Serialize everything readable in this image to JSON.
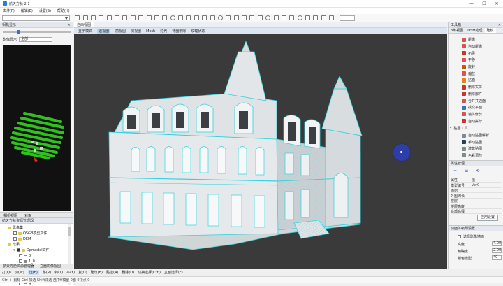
{
  "window": {
    "title": "航天方舱 2.1",
    "minimize": "—",
    "maximize": "☐",
    "close": "✕"
  },
  "menu": [
    "文件(F)",
    "编辑(E)",
    "设置(S)",
    "帮助(H)"
  ],
  "left_panel": {
    "title": "相机显示",
    "close": "×",
    "filter_label": "影像显示",
    "filter_value": "全部",
    "tabs": [
      "相机视图",
      "对象"
    ]
  },
  "tree": {
    "title": "航天方舱资源管理器",
    "items": [
      {
        "label": "影像集",
        "indent": 1,
        "kind": "folder",
        "checked": false,
        "toggle": ""
      },
      {
        "label": "OSGB模型文件",
        "indent": 2,
        "kind": "box",
        "checked": false,
        "toggle": ""
      },
      {
        "label": "DEM",
        "indent": 2,
        "kind": "box",
        "checked": false,
        "toggle": ""
      },
      {
        "label": "成果",
        "indent": 1,
        "kind": "folder",
        "checked": false,
        "toggle": ""
      },
      {
        "label": "Dpmodel文件",
        "indent": 2,
        "kind": "box",
        "checked": true,
        "toggle": "▾"
      },
      {
        "label": "0",
        "indent": 3,
        "kind": "layer",
        "checked": false,
        "toggle": ""
      },
      {
        "label": "1_0",
        "indent": 3,
        "kind": "layer",
        "checked": false,
        "toggle": ""
      },
      {
        "label": "1",
        "indent": 3,
        "kind": "layer",
        "checked": false,
        "toggle": ""
      },
      {
        "label": "2",
        "indent": 3,
        "kind": "layer",
        "checked": false,
        "toggle": ""
      },
      {
        "label": "3",
        "indent": 3,
        "kind": "layer",
        "checked": false,
        "toggle": ""
      },
      {
        "label": "4",
        "indent": 3,
        "kind": "layer",
        "checked": false,
        "toggle": ""
      }
    ]
  },
  "bottom_tabs": [
    "航天方舱资源管理器",
    "立面影像视图"
  ],
  "view_tabs": [
    {
      "label": "自由视图",
      "active": true
    }
  ],
  "view_toolbar": [
    {
      "label": "显示模式",
      "active": false
    },
    {
      "label": "透视图",
      "active": true
    },
    {
      "label": "前视图",
      "active": false
    },
    {
      "label": "侧视图",
      "active": false
    },
    {
      "label": "Mesh",
      "active": false
    },
    {
      "label": "灯光",
      "active": false
    },
    {
      "label": "背面剔除",
      "active": false
    },
    {
      "label": "纹理状态",
      "active": false
    }
  ],
  "right_panel": {
    "title": "工具箱",
    "close": "×",
    "tabs": [
      {
        "label": "3维视图",
        "active": false
      },
      {
        "label": "DSM处理",
        "active": false
      },
      {
        "label": "建模",
        "active": true
      }
    ],
    "tools": [
      {
        "label": "屋檐",
        "color": "#d9534f"
      },
      {
        "label": "自动屋檐",
        "color": "#d9534f"
      },
      {
        "label": "拓展",
        "color": "#c0392b"
      },
      {
        "label": "平移",
        "color": "#d9534f"
      },
      {
        "label": "旋转",
        "color": "#d35400"
      },
      {
        "label": "缩放",
        "color": "#d9534f"
      },
      {
        "label": "贴面",
        "color": "#e67e22"
      },
      {
        "label": "删除实体",
        "color": "#c0392b"
      },
      {
        "label": "删除部件",
        "color": "#c0392b"
      },
      {
        "label": "合并共边面",
        "color": "#d9534f"
      },
      {
        "label": "截交平面",
        "color": "#2980b9"
      },
      {
        "label": "墙体修剪",
        "color": "#d9534f"
      },
      {
        "label": "自动拼分",
        "color": "#c0392b"
      }
    ],
    "group_title": "贴图工具",
    "group_toggle": "▾",
    "texture_tools": [
      {
        "label": "自动贴图解析",
        "color": "#7f8c8d"
      },
      {
        "label": "手动贴图",
        "color": "#2c3e50"
      },
      {
        "label": "建筑贴图",
        "color": "#7f8c8d"
      },
      {
        "label": "色彩调节",
        "color": "#7f8c8d"
      }
    ]
  },
  "attributes": {
    "title": "属性管理",
    "icons": [
      "+",
      "☰",
      "⟲"
    ],
    "rows": [
      {
        "k": "属性",
        "v": "值"
      },
      {
        "k": "模型编号",
        "v": "Ver0"
      },
      {
        "k": "面积",
        "v": ""
      },
      {
        "k": "外围周长",
        "v": ""
      },
      {
        "k": "楼层",
        "v": ""
      },
      {
        "k": "楼层高度",
        "v": ""
      },
      {
        "k": "底部高程",
        "v": ""
      }
    ],
    "apply": "应用设置"
  },
  "settings": {
    "title": "切面体吸附设置",
    "check_label": "选择影像墙面",
    "rows": [
      {
        "label": "高度",
        "value": "4.00"
      },
      {
        "label": "精确度",
        "value": "2.00"
      },
      {
        "label": "颜色模型",
        "value": "40"
      }
    ]
  },
  "command_bar": [
    {
      "label": "打(Q)",
      "active": false
    },
    {
      "label": "切(W)",
      "active": false
    },
    {
      "label": "选(E)",
      "active": true
    },
    {
      "label": "移(R)",
      "active": false
    },
    {
      "label": "转(T)",
      "active": false
    },
    {
      "label": "平(Y)",
      "active": false
    },
    {
      "label": "复(U)",
      "active": false
    },
    {
      "label": "建筑(B)",
      "active": false
    },
    {
      "label": "贴选(A)",
      "active": false
    },
    {
      "label": "删除(D)",
      "active": false
    },
    {
      "label": "切换选择(Ctrl)",
      "active": false
    },
    {
      "label": "立面选择(F)",
      "active": false
    }
  ],
  "status": "Ctrl + 鼠标 Ctrl 加选  Shift减选  选中0模型 0面 0顶点 0"
}
